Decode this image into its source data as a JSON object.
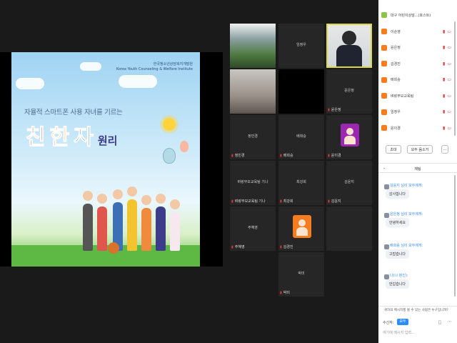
{
  "slide": {
    "org": "한국청소년상담복지개발원",
    "org_en": "Korea Youth Counseling & Welfare Institute",
    "subtitle": "자율적 스마트폰 사용 자녀를 기르는",
    "title_chars": [
      "친",
      "한",
      "자"
    ],
    "title_suffix": "원리"
  },
  "tiles": [
    {
      "name": "",
      "foot": "",
      "type": "video"
    },
    {
      "name": "임정우",
      "foot": "",
      "type": "name"
    },
    {
      "name": "",
      "foot": "",
      "type": "speaker"
    },
    {
      "name": "",
      "foot": "",
      "type": "video2"
    },
    {
      "name": "",
      "foot": "",
      "type": "black"
    },
    {
      "name": "윤은정",
      "foot": "윤은정",
      "type": "name"
    },
    {
      "name": "정민경",
      "foot": "정민경",
      "type": "name"
    },
    {
      "name": "배희승",
      "foot": "배희승",
      "type": "name"
    },
    {
      "name": "",
      "foot": "윤이경",
      "type": "avatar-purple"
    },
    {
      "name": "벼랑부모교육팀 기나",
      "foot": "벼랑부모교육팀 기나",
      "type": "name"
    },
    {
      "name": "최강희",
      "foot": "최강희",
      "type": "name"
    },
    {
      "name": "김윤지",
      "foot": "김윤지",
      "type": "name"
    },
    {
      "name": "주혜영",
      "foot": "주혜영",
      "type": "name"
    },
    {
      "name": "",
      "foot": "김경진",
      "type": "avatar-orange"
    },
    {
      "name": "",
      "foot": "",
      "type": "empty"
    },
    {
      "name": "박미",
      "foot": "박미",
      "type": "name"
    }
  ],
  "panel": {
    "top_label": "대구 어린이상담...(호스트)",
    "participants": [
      {
        "name": "이순영"
      },
      {
        "name": "윤은정"
      },
      {
        "name": "김경진"
      },
      {
        "name": "배희승"
      },
      {
        "name": "벼랑부모교육팀"
      },
      {
        "name": "임정우"
      },
      {
        "name": "윤이경"
      }
    ],
    "invite_btn": "초대",
    "mute_all_btn": "모두 음소거",
    "more_btn": "...",
    "chat_title": "채팅",
    "messages": [
      {
        "from": "김윤지 님이 모두에게:",
        "text": "감사합니다"
      },
      {
        "from": "윤은정 님이 모두에게:",
        "text": "안녕하세요"
      },
      {
        "from": "배희승 님이 모두에게:",
        "text": "고맙습니다"
      },
      {
        "from": "나(나 본인):",
        "text": "반갑습니다"
      }
    ],
    "notice": "귀하의 메시지를 볼 수 있는 사람은 누구입니까?",
    "to_label": "수신자:",
    "to_value": "모두",
    "input_placeholder": "여기에 메시지 입력..."
  }
}
